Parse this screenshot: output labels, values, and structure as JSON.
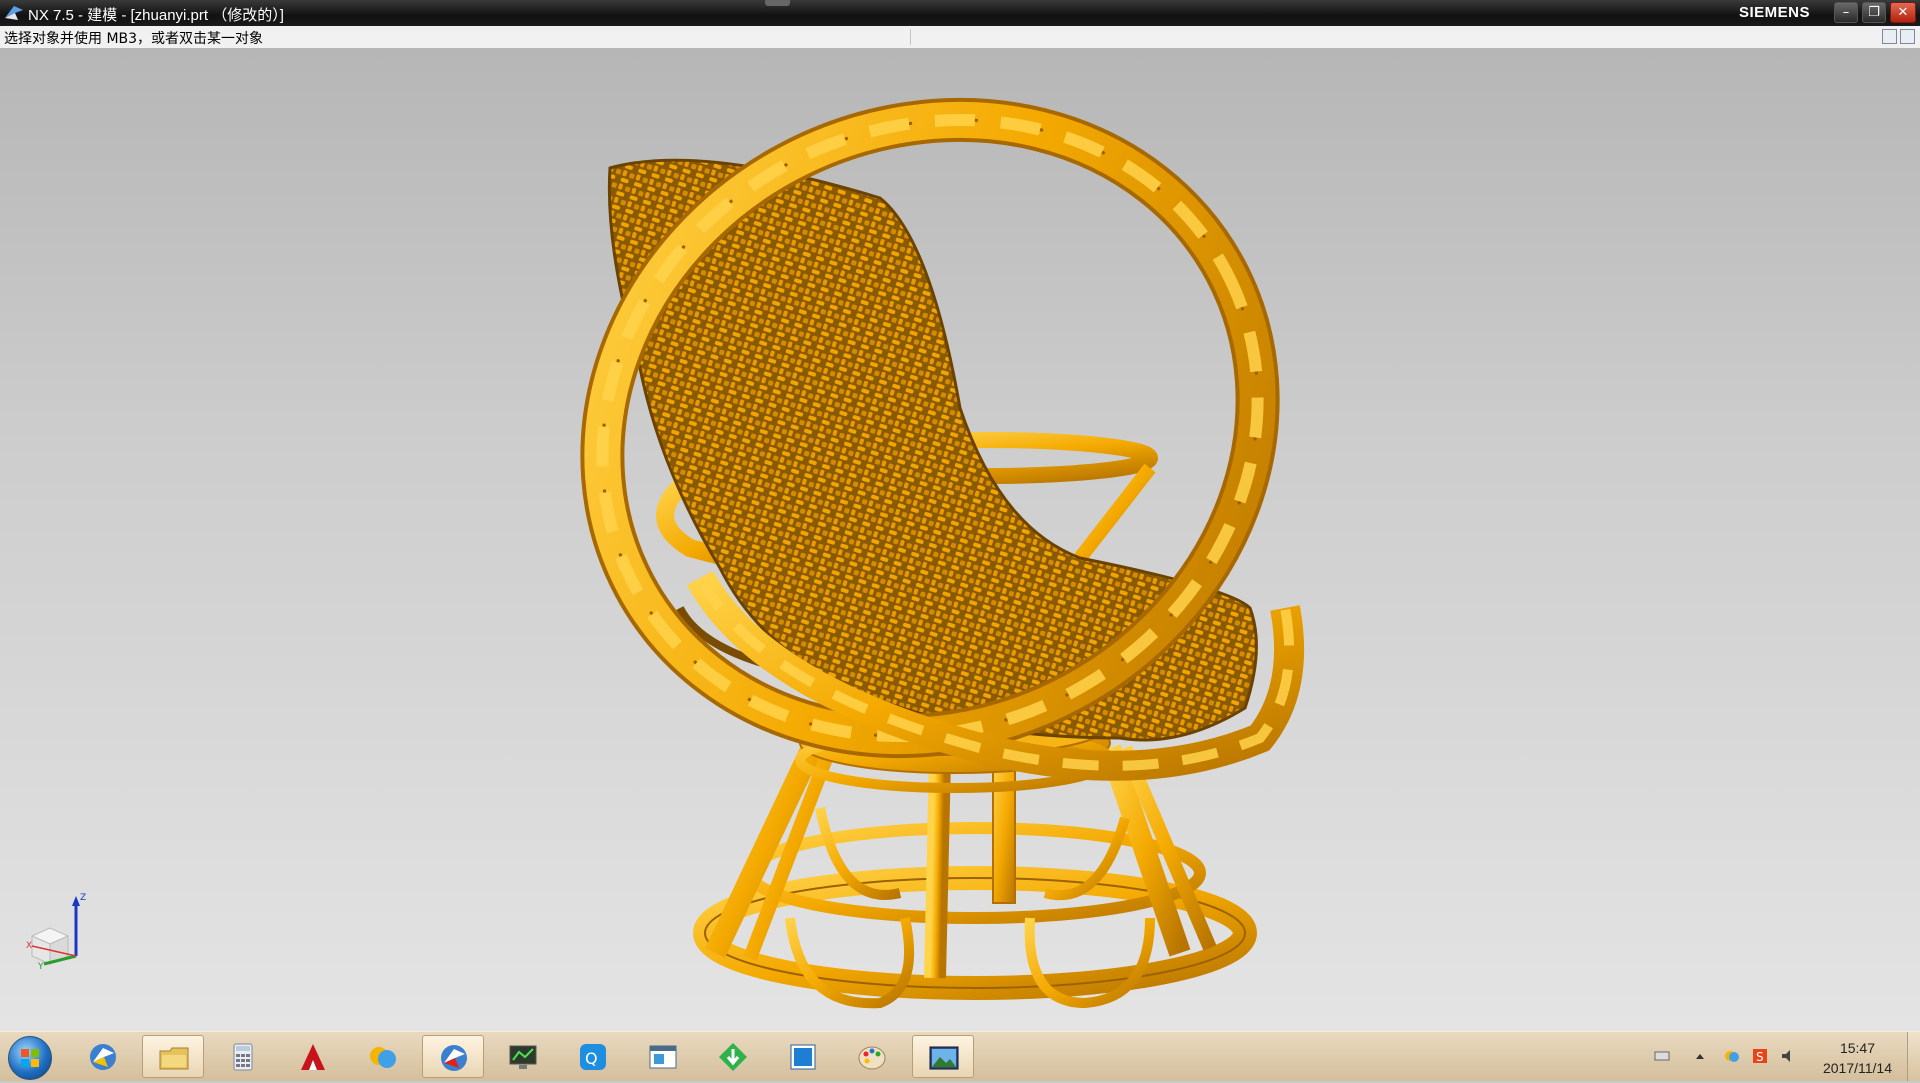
{
  "window": {
    "title": "NX 7.5 - 建模 - [zhuanyi.prt （修改的）]",
    "brand": "SIEMENS",
    "controls": [
      "minimize",
      "restore",
      "close"
    ]
  },
  "cue_line": {
    "text": "选择对象并使用 MB3，或者双击某一对象"
  },
  "viewport": {
    "model": "wicker swivel chair",
    "model_color": "#f4a900",
    "background_top": "#b6b6b6",
    "background_bottom": "#e4e4e4",
    "triad_labels": {
      "x": "X",
      "y": "Y",
      "z": "Z"
    }
  },
  "taskbar": {
    "apps": [
      {
        "name": "nx-icon"
      },
      {
        "name": "explorer-folder-icon"
      },
      {
        "name": "calculator-icon"
      },
      {
        "name": "autocad-icon"
      },
      {
        "name": "messenger-icon"
      },
      {
        "name": "nx-icon",
        "active": true
      },
      {
        "name": "monitor-icon"
      },
      {
        "name": "qq-icon"
      },
      {
        "name": "window-icon"
      },
      {
        "name": "download-arrow-icon"
      },
      {
        "name": "blue-square-icon"
      },
      {
        "name": "paint-palette-icon"
      },
      {
        "name": "picture-viewer-icon"
      }
    ],
    "tray": {
      "icons": [
        "keyboard-icon",
        "show-hidden-arrow-icon",
        "network-icon",
        "sogou-s-icon",
        "speaker-icon"
      ]
    },
    "clock": {
      "time": "15:47",
      "date": "2017/11/14"
    }
  }
}
